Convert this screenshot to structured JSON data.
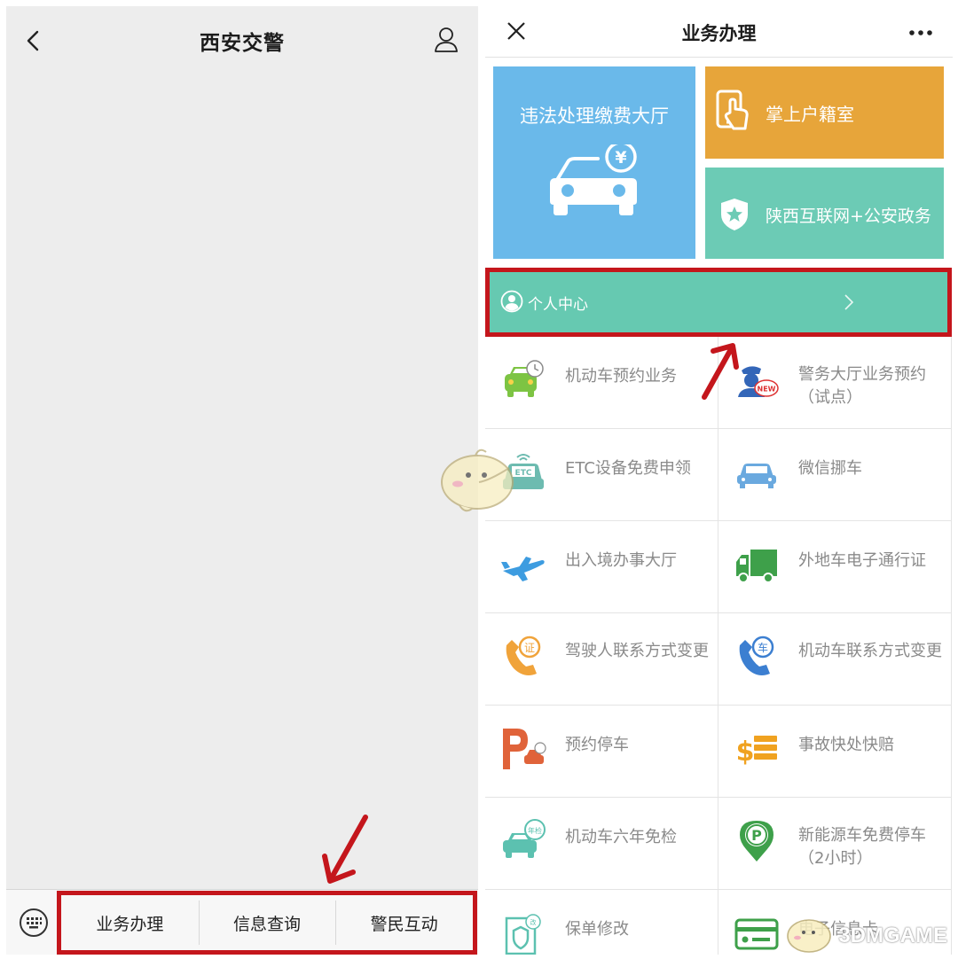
{
  "left_panel": {
    "title": "西安交警",
    "icons": {
      "back": "back-chevron-icon",
      "user": "user-profile-icon",
      "keyboard": "keyboard-toggle-icon"
    },
    "bottom_menu": [
      "业务办理",
      "信息查询",
      "警民互动"
    ]
  },
  "right_panel": {
    "title": "业务办理",
    "icons": {
      "close": "close-icon",
      "more": "more-dots-icon"
    },
    "tiles": {
      "violation_hall": "违法处理缴费大厅",
      "household_registry": "掌上户籍室",
      "shaanxi_police": "陕西互联网+公安政务"
    },
    "personal_center": "个人中心",
    "services": [
      {
        "label": "机动车预约业务",
        "icon": "car-appointment-icon"
      },
      {
        "label": "警务大厅业务预约（试点）",
        "icon": "police-new-icon"
      },
      {
        "label": "ETC设备免费申领",
        "icon": "etc-car-icon"
      },
      {
        "label": "微信挪车",
        "icon": "move-car-icon"
      },
      {
        "label": "出入境办事大厅",
        "icon": "airplane-icon"
      },
      {
        "label": "外地车电子通行证",
        "icon": "truck-icon"
      },
      {
        "label": "驾驶人联系方式变更",
        "icon": "driver-phone-icon"
      },
      {
        "label": "机动车联系方式变更",
        "icon": "vehicle-phone-icon"
      },
      {
        "label": "预约停车",
        "icon": "parking-reserve-icon"
      },
      {
        "label": "事故快处快赔",
        "icon": "accident-claim-icon"
      },
      {
        "label": "机动车六年免检",
        "icon": "inspection-exempt-icon"
      },
      {
        "label": "新能源车免费停车（2小时）",
        "icon": "ev-parking-icon"
      },
      {
        "label": "保单修改",
        "icon": "policy-edit-icon"
      },
      {
        "label": "电子信息卡",
        "icon": "e-card-icon"
      }
    ]
  },
  "watermark": "3DMGAME",
  "colors": {
    "highlight_border": "#c4161c",
    "tile_blue": "#6ab9ea",
    "tile_orange": "#e7a53a",
    "tile_teal": "#6ccbb5",
    "personal_center_bg": "#66c9b1"
  }
}
